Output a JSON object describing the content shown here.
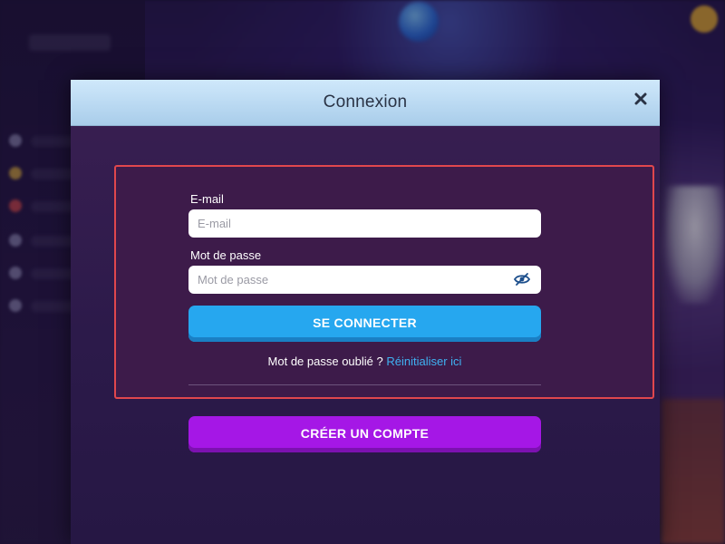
{
  "modal": {
    "title": "Connexion",
    "close_icon": "close-icon"
  },
  "login_form": {
    "email_label": "E-mail",
    "email_placeholder": "E-mail",
    "email_value": "",
    "password_label": "Mot de passe",
    "password_placeholder": "Mot de passe",
    "password_value": "",
    "password_toggle_icon": "eye-slash-icon",
    "submit_label": "SE CONNECTER",
    "forgot_text": "Mot de passe oublié ?",
    "reset_link": "Réinitialiser ici"
  },
  "register": {
    "create_account_label": "CRÉER UN COMPTE"
  },
  "colors": {
    "header_bg": "#cfe8fb",
    "modal_bg": "#2c1a4a",
    "highlight_border": "#e0474d",
    "primary_button": "#26a7ef",
    "secondary_button": "#a517e6",
    "link": "#3fb2f2"
  }
}
